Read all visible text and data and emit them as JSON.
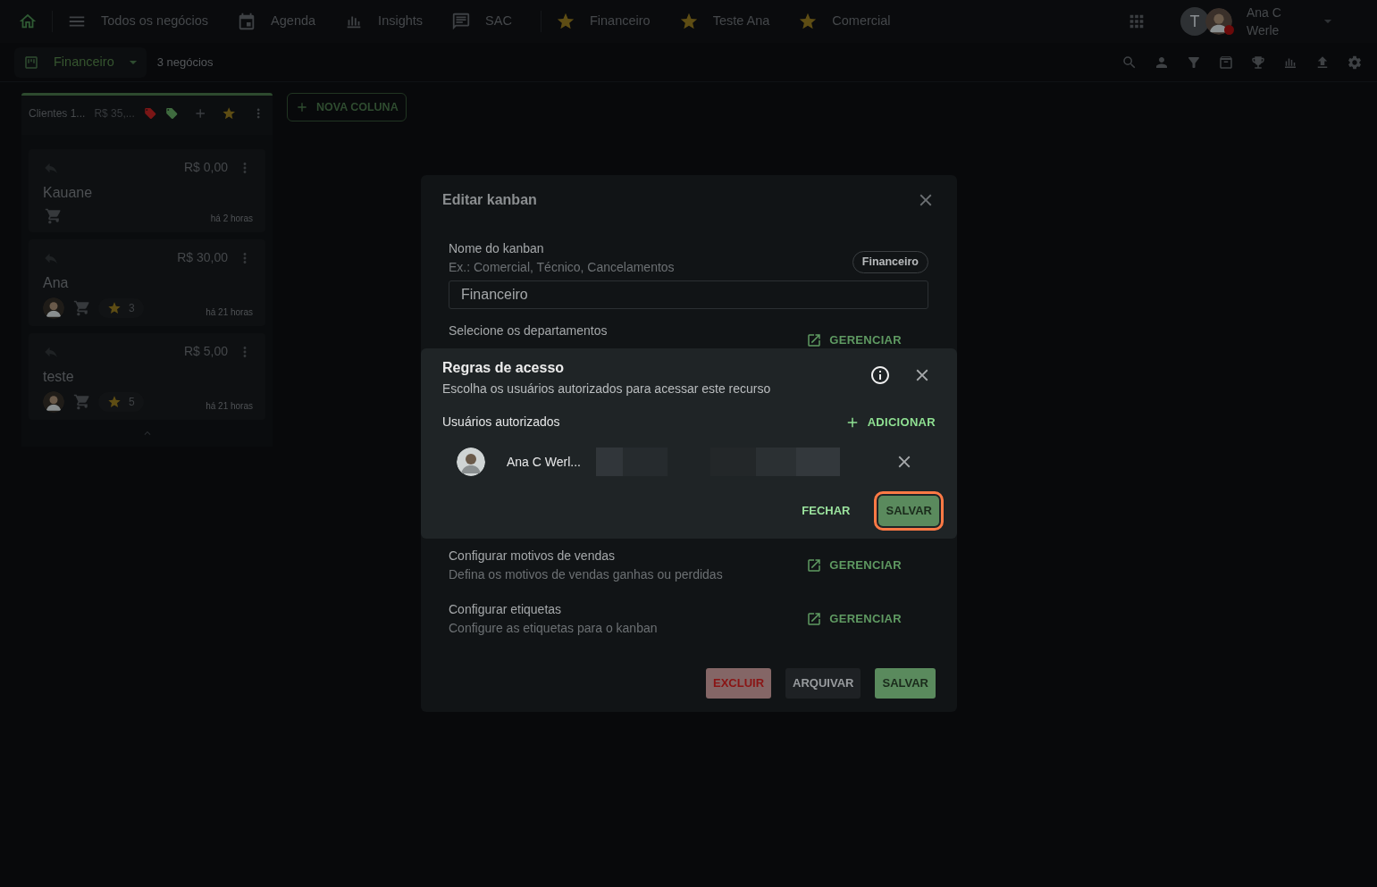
{
  "topbar": {
    "links": [
      {
        "kind": "link",
        "label": "Todos os negócios"
      },
      {
        "kind": "link",
        "label": "Agenda"
      },
      {
        "kind": "link",
        "label": "Insights"
      },
      {
        "kind": "link",
        "label": "SAC"
      },
      {
        "kind": "favorite",
        "label": "Financeiro"
      },
      {
        "kind": "favorite",
        "label": "Teste Ana"
      },
      {
        "kind": "favorite",
        "label": "Comercial"
      }
    ],
    "user": {
      "initial": "T",
      "name_lines": [
        "Ana C",
        "Werle"
      ]
    }
  },
  "subbar": {
    "kanban": "Financeiro",
    "count": "3 negócios"
  },
  "column": {
    "title": "Clientes 1...",
    "total": "R$ 35,...",
    "tags": [
      {
        "color": "#7a1616"
      },
      {
        "color": "#3f6b3f"
      }
    ],
    "cards": [
      {
        "value": "R$ 0,00",
        "name": "Kauane",
        "time": "há 2 horas",
        "has_avatar": false
      },
      {
        "value": "R$ 30,00",
        "name": "Ana",
        "time": "há 21 horas",
        "has_avatar": true,
        "rating": "3"
      },
      {
        "value": "R$ 5,00",
        "name": "teste",
        "time": "há 21 horas",
        "has_avatar": true,
        "rating": "5"
      }
    ]
  },
  "new_column": "NOVA COLUNA",
  "edit_dialog": {
    "title": "Editar kanban",
    "name_label": "Nome do kanban",
    "name_hint": "Ex.: Comercial, Técnico, Cancelamentos",
    "name_chip": "Financeiro",
    "name_value": "Financeiro",
    "sections": [
      {
        "title": "Selecione os departamentos",
        "action": "GERENCIAR"
      },
      {
        "title": "Configurar motivos de vendas",
        "subtitle": "Defina os motivos de vendas ganhas ou perdidas",
        "action": "GERENCIAR"
      },
      {
        "title": "Configurar etiquetas",
        "subtitle": "Configure as etiquetas para o kanban",
        "action": "GERENCIAR"
      }
    ],
    "buttons": [
      {
        "kind": "danger",
        "label": "EXCLUIR"
      },
      {
        "kind": "neutral",
        "label": "ARQUIVAR"
      },
      {
        "kind": "primary",
        "label": "SALVAR"
      }
    ]
  },
  "access_dialog": {
    "title": "Regras de acesso",
    "subtitle": "Escolha os usuários autorizados para acessar este recurso",
    "users_label": "Usuários autorizados",
    "add": "ADICIONAR",
    "users": [
      {
        "name": "Ana C Werl..."
      }
    ],
    "buttons": [
      {
        "kind": "text",
        "label": "FECHAR",
        "focused": false
      },
      {
        "kind": "primary",
        "label": "SALVAR",
        "focused": true
      }
    ]
  }
}
